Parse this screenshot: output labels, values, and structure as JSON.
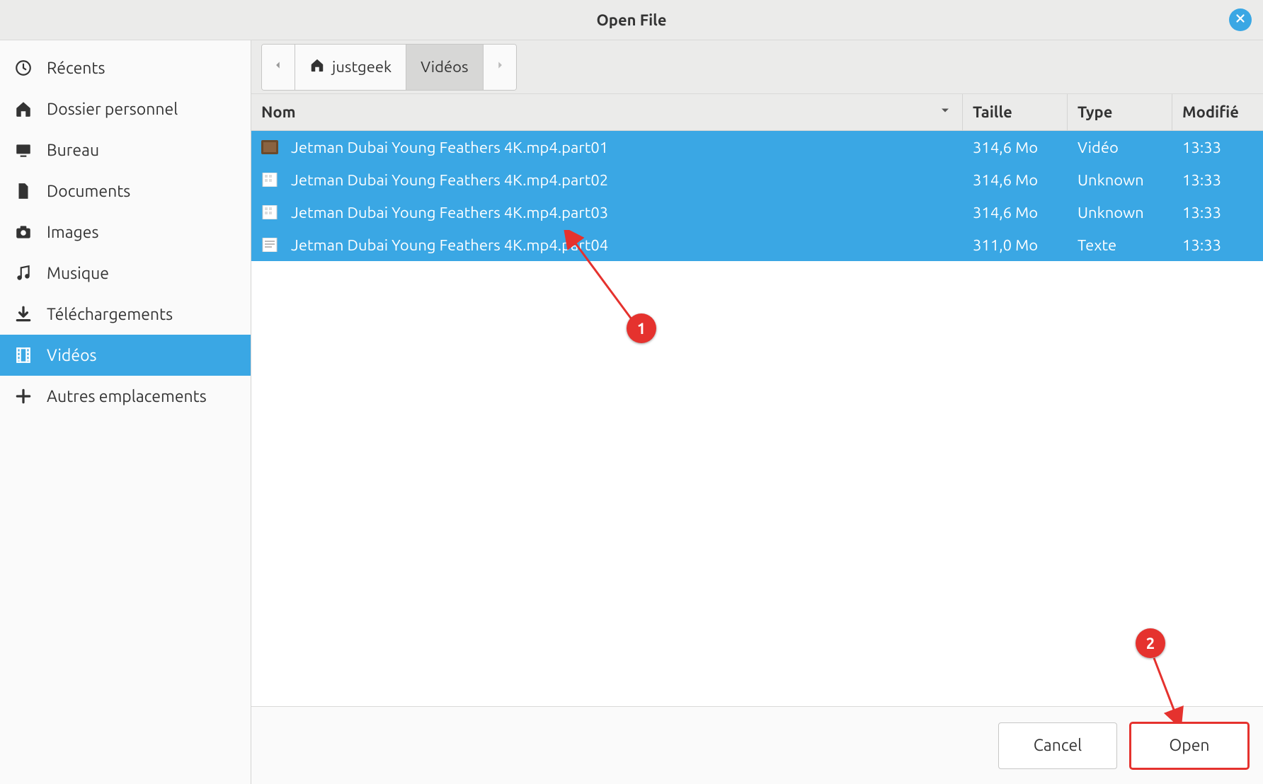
{
  "title": "Open File",
  "sidebar": {
    "items": [
      {
        "label": "Récents",
        "icon": "clock-icon",
        "active": false
      },
      {
        "label": "Dossier personnel",
        "icon": "home-icon",
        "active": false
      },
      {
        "label": "Bureau",
        "icon": "desktop-icon",
        "active": false
      },
      {
        "label": "Documents",
        "icon": "document-icon",
        "active": false
      },
      {
        "label": "Images",
        "icon": "camera-icon",
        "active": false
      },
      {
        "label": "Musique",
        "icon": "music-icon",
        "active": false
      },
      {
        "label": "Téléchargements",
        "icon": "download-icon",
        "active": false
      },
      {
        "label": "Vidéos",
        "icon": "film-icon",
        "active": true
      },
      {
        "label": "Autres emplacements",
        "icon": "plus-icon",
        "active": false
      }
    ]
  },
  "breadcrumb": {
    "segments": [
      {
        "label": "justgeek",
        "icon": "home-icon",
        "current": false
      },
      {
        "label": "Vidéos",
        "icon": null,
        "current": true
      }
    ]
  },
  "columns": {
    "name": "Nom",
    "size": "Taille",
    "type": "Type",
    "modified": "Modifié"
  },
  "files": [
    {
      "name": "Jetman Dubai Young Feathers 4K.mp4.part01",
      "size": "314,6 Mo",
      "type": "Vidéo",
      "modified": "13:33",
      "icon": "video-thumb-icon",
      "selected": true
    },
    {
      "name": "Jetman Dubai Young Feathers 4K.mp4.part02",
      "size": "314,6 Mo",
      "type": "Unknown",
      "modified": "13:33",
      "icon": "unknown-file-icon",
      "selected": true
    },
    {
      "name": "Jetman Dubai Young Feathers 4K.mp4.part03",
      "size": "314,6 Mo",
      "type": "Unknown",
      "modified": "13:33",
      "icon": "unknown-file-icon",
      "selected": true
    },
    {
      "name": "Jetman Dubai Young Feathers 4K.mp4.part04",
      "size": "311,0 Mo",
      "type": "Texte",
      "modified": "13:33",
      "icon": "text-file-icon",
      "selected": true
    }
  ],
  "buttons": {
    "cancel": "Cancel",
    "open": "Open"
  },
  "annotations": {
    "badge1": "1",
    "badge2": "2"
  }
}
